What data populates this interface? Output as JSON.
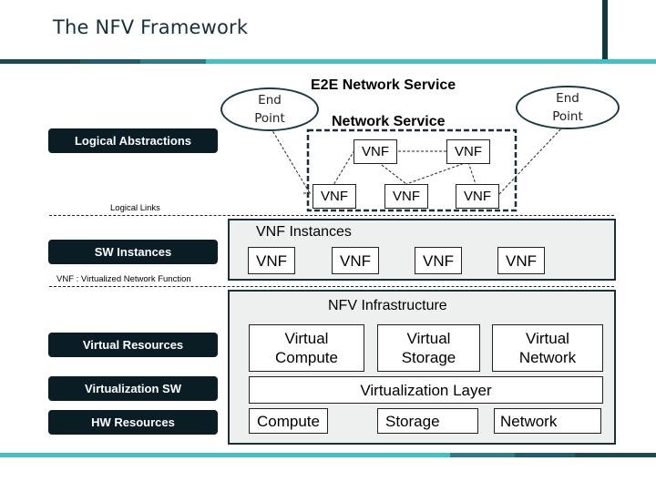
{
  "header": {
    "title": "The NFV Framework"
  },
  "colors": {
    "stripe_dark": "#1a4b57",
    "stripe_mid": "#1f5f6c",
    "stripe_teal": "#2a7d8a",
    "stripe_light": "#3fc1c9",
    "pill_bg": "#0b1d24",
    "panel_bg": "#eef0f0"
  },
  "left_labels": {
    "logical_abstractions": "Logical Abstractions",
    "logical_links": "Logical Links",
    "sw_instances": "SW Instances",
    "vnf_note": "VNF : Virtualized Network Function",
    "virtual_resources": "Virtual Resources",
    "virtualization_sw": "Virtualization SW",
    "hw_resources": "HW Resources"
  },
  "logical": {
    "e2e_title": "E2E Network Service",
    "ns_title": "Network Service",
    "end_point_left": "End Point",
    "end_point_right": "End Point",
    "vnfs": [
      "VNF",
      "VNF",
      "VNF",
      "VNF",
      "VNF"
    ]
  },
  "vnf_instances": {
    "title": "VNF Instances",
    "items": [
      "VNF",
      "VNF",
      "VNF",
      "VNF"
    ]
  },
  "nfvi": {
    "title": "NFV Infrastructure",
    "virtual": [
      "Virtual Compute",
      "Virtual Storage",
      "Virtual Network"
    ],
    "virtualization_layer": "Virtualization Layer",
    "hardware": [
      "Compute",
      "Storage",
      "Network"
    ]
  }
}
